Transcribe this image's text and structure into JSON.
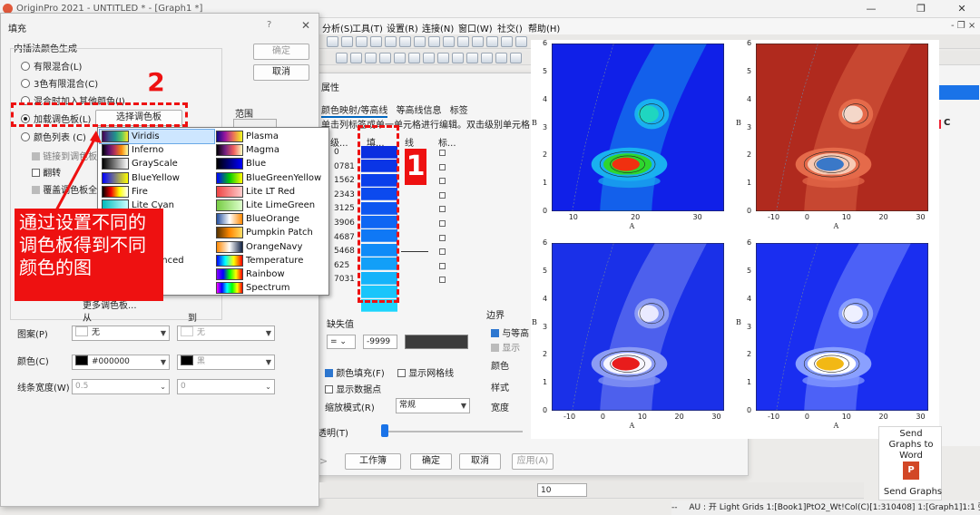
{
  "app": {
    "title": "OriginPro 2021 - UNTITLED * - [Graph1 *]",
    "menu": [
      "分析(S)",
      "工具(T)",
      "设置(R)",
      "连接(N)",
      "窗口(W)",
      "社交()",
      "帮助(H)"
    ],
    "window_controls": [
      "—",
      "❐",
      "✕"
    ],
    "sub_controls": "- ❐ ×",
    "status_left": "--",
    "status": "AU : 开 Light Grids 1:[Book1]PtO2_Wt!Col(C)[1:310408] 1:[Graph1]1:1 弧度",
    "zoom": "10",
    "right_panel_label": "C",
    "send_word": "Send Graphs to Word",
    "send_graphs": "Send Graphs"
  },
  "fill_dialog": {
    "title": "填充",
    "help": "?",
    "close": "✕",
    "group_label": "内插法颜色生成",
    "options": [
      "有限混合(L)",
      "3色有限混合(C)",
      "混合时加入其他颜色(I)",
      "加载调色板(L)",
      "颜色列表 (C)"
    ],
    "selected_option": 3,
    "load_palette_button": "选择调色板",
    "ok": "确定",
    "cancel": "取消",
    "range_label": "范围",
    "sub_checks": [
      "链接到调色板",
      "翻转",
      "覆盖调色板全"
    ],
    "more_palettes": "更多调色板...",
    "from_label": "从",
    "to_label": "到",
    "pattern_label": "图案(P)",
    "pattern_from": "无",
    "pattern_to": "无",
    "color_label": "颜色(C)",
    "color_from": "#000000",
    "color_to": "黑",
    "linewidth_label": "线条宽度(W)",
    "linewidth_from": "0.5",
    "linewidth_to": "0"
  },
  "palettes": {
    "left": [
      {
        "name": "Viridis",
        "grad": "linear-gradient(90deg,#440154,#3b528b,#21918c,#5ec962,#fde725)"
      },
      {
        "name": "Inferno",
        "grad": "linear-gradient(90deg,#000004,#57106e,#bc3754,#f98e09,#fcffa4)"
      },
      {
        "name": "GrayScale",
        "grad": "linear-gradient(90deg,#000,#fff)"
      },
      {
        "name": "BlueYellow",
        "grad": "linear-gradient(90deg,#0000ff,#ffff00)"
      },
      {
        "name": "Fire",
        "grad": "linear-gradient(90deg,#000,#e00,#ff0,#fff)"
      },
      {
        "name": "Lite Cyan",
        "grad": "linear-gradient(90deg,#0bb,#cff)"
      },
      {
        "name": "pBio",
        "grad": "linear-gradient(90deg,#2b4,#fe6,#e33)"
      },
      {
        "name": "meter",
        "grad": "linear-gradient(90deg,#00f,#0f0,#f00)"
      },
      {
        "name": "ple",
        "grad": "linear-gradient(90deg,#306,#a5f)"
      },
      {
        "name": "w Balanced",
        "grad": "linear-gradient(90deg,#2457b5,#fff,#c3243b)"
      }
    ],
    "right": [
      {
        "name": "Plasma",
        "grad": "linear-gradient(90deg,#0d0887,#9c179e,#ed7953,#f0f921)"
      },
      {
        "name": "Magma",
        "grad": "linear-gradient(90deg,#000004,#721f81,#f1605d,#fcfdbf)"
      },
      {
        "name": "Blue",
        "grad": "linear-gradient(90deg,#000,#00f)"
      },
      {
        "name": "BlueGreenYellow",
        "grad": "linear-gradient(90deg,#00f,#0c0,#ff0)"
      },
      {
        "name": "Lite LT Red",
        "grad": "linear-gradient(90deg,#e44,#fcc)"
      },
      {
        "name": "Lite LimeGreen",
        "grad": "linear-gradient(90deg,#7c4,#dfc)"
      },
      {
        "name": "BlueOrange",
        "grad": "linear-gradient(90deg,#2450a0,#fff,#f80)"
      },
      {
        "name": "Pumpkin Patch",
        "grad": "linear-gradient(90deg,#530,#f80,#fd6)"
      },
      {
        "name": "OrangeNavy",
        "grad": "linear-gradient(90deg,#f80,#fff,#124)"
      },
      {
        "name": "Temperature",
        "grad": "linear-gradient(90deg,#00f,#0ff,#ff0,#f00)"
      },
      {
        "name": "Rainbow",
        "grad": "linear-gradient(90deg,#80f,#00f,#0f0,#ff0,#f00)"
      },
      {
        "name": "Spectrum",
        "grad": "linear-gradient(90deg,#f0f,#00f,#0ff,#0f0,#ff0,#f00)"
      }
    ]
  },
  "attr_dialog": {
    "title": "属性",
    "tabs": [
      "颜色映射/等高线",
      "等高线信息",
      "标签"
    ],
    "hint": "单击列标签或单一单元格进行编辑。双击级别单元格",
    "headers": [
      "级...",
      "填...",
      "线",
      "标..."
    ],
    "levels": [
      "0",
      "0781",
      "1562",
      "2343",
      "3125",
      "3906",
      "4687",
      "5468",
      "625",
      "7031"
    ],
    "missing_label": "缺失值",
    "missing_op": "=",
    "missing_value": "-9999",
    "border_label": "边界",
    "border_checks": [
      "与等高",
      "显示"
    ],
    "border_rows": [
      "颜色",
      "样式",
      "宽度"
    ],
    "fill_check": "颜色填充(F)",
    "gridline_check": "显示网格线",
    "datapoint_check": "显示数据点",
    "scale_label": "缩放模式(R)",
    "scale_value": "常规",
    "transparency_label": "透明(T)",
    "buttons": [
      "工作簿",
      "确定",
      "取消",
      "应用(A)"
    ],
    "fill_colors": [
      "#0a2ee0",
      "#0a35e6",
      "#0b3fea",
      "#0c4aee",
      "#0d56f0",
      "#0e66f3",
      "#0f78f5",
      "#108bf7",
      "#129ff8",
      "#15b3fa",
      "#19c5fb",
      "#1dd4fc"
    ]
  },
  "annotations": {
    "num1": "1",
    "num2": "2",
    "callout": "通过设置不同的调色板得到不同颜色的图"
  },
  "graphs": {
    "yticks": [
      "6",
      "5",
      "4",
      "3",
      "2",
      "1",
      "0"
    ],
    "xticks": [
      "-10",
      "0",
      "10",
      "20",
      "30"
    ],
    "xticks_left": [
      "10",
      "20",
      "30"
    ],
    "xlabel": "A",
    "ylabel": "B",
    "palettes": [
      "rainbow",
      "red",
      "bluewhitered",
      "blueyellow"
    ]
  }
}
